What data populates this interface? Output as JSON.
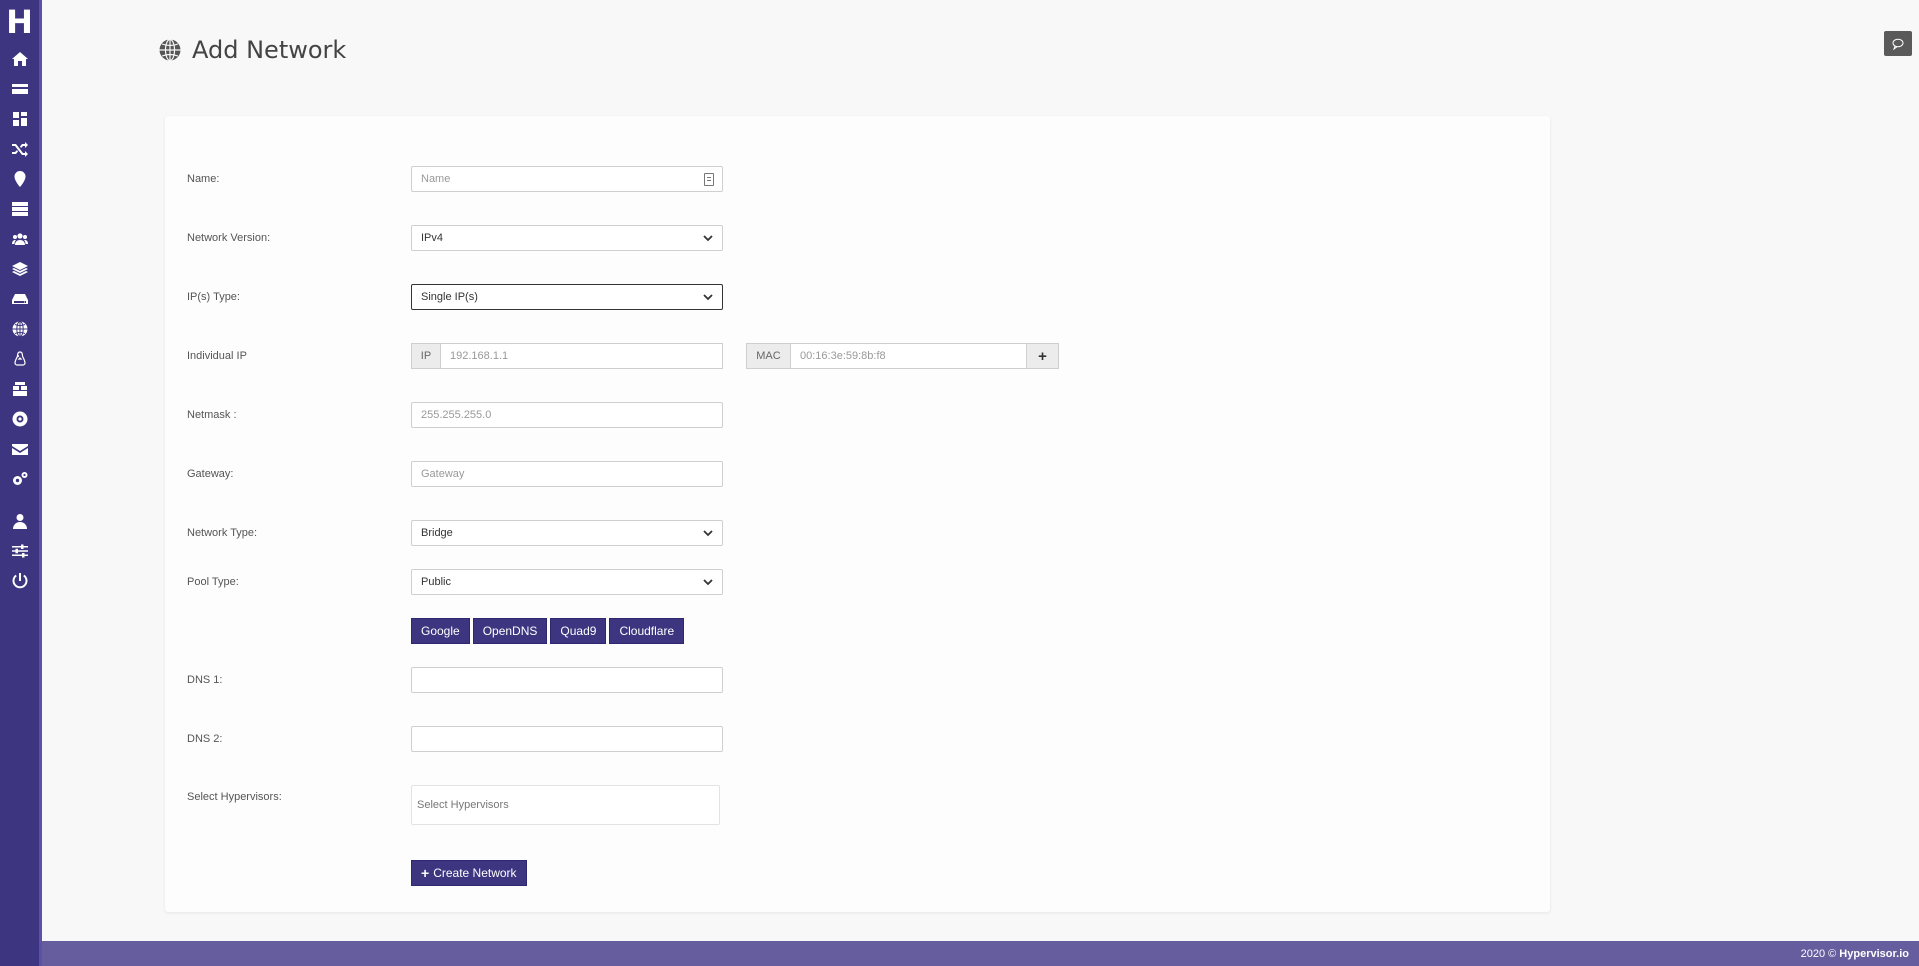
{
  "sidebar": {
    "logo": "H",
    "items": [
      {
        "icon": "home-icon",
        "name": "home"
      },
      {
        "icon": "card-icon",
        "name": "billing"
      },
      {
        "icon": "dashboard-icon",
        "name": "dashboard"
      },
      {
        "icon": "shuffle-icon",
        "name": "migrations"
      },
      {
        "icon": "location-pin-icon",
        "name": "locations"
      },
      {
        "icon": "server-icon",
        "name": "servers"
      },
      {
        "icon": "users-icon",
        "name": "users"
      },
      {
        "icon": "layers-icon",
        "name": "layers"
      },
      {
        "icon": "hard-drive-icon",
        "name": "storage"
      },
      {
        "icon": "globe-icon",
        "name": "networks"
      },
      {
        "icon": "linux-icon",
        "name": "os-templates"
      },
      {
        "icon": "boxes-icon",
        "name": "packages"
      },
      {
        "icon": "disc-icon",
        "name": "isos"
      },
      {
        "icon": "envelope-icon",
        "name": "mail"
      },
      {
        "icon": "cogs-icon",
        "name": "settings"
      }
    ],
    "bottom_items": [
      {
        "icon": "user-icon",
        "name": "profile"
      },
      {
        "icon": "sliders-icon",
        "name": "preferences"
      },
      {
        "icon": "power-icon",
        "name": "logout"
      }
    ]
  },
  "header": {
    "title": "Add Network"
  },
  "form": {
    "name": {
      "label": "Name:",
      "placeholder": "Name"
    },
    "network_version": {
      "label": "Network Version:",
      "value": "IPv4"
    },
    "ip_type": {
      "label": "IP(s) Type:",
      "value": "Single IP(s)"
    },
    "individual_ip": {
      "label": "Individual IP",
      "ip_addon": "IP",
      "ip_placeholder": "192.168.1.1",
      "mac_addon": "MAC",
      "mac_placeholder": "00:16:3e:59:8b:f8",
      "add_label": "+"
    },
    "netmask": {
      "label": "Netmask :",
      "placeholder": "255.255.255.0"
    },
    "gateway": {
      "label": "Gateway:",
      "placeholder": "Gateway"
    },
    "network_type": {
      "label": "Network Type:",
      "value": "Bridge"
    },
    "pool_type": {
      "label": "Pool Type:",
      "value": "Public"
    },
    "dns_presets": [
      "Google",
      "OpenDNS",
      "Quad9",
      "Cloudflare"
    ],
    "dns1": {
      "label": "DNS 1:",
      "value": ""
    },
    "dns2": {
      "label": "DNS 2:",
      "value": ""
    },
    "hypervisors": {
      "label": "Select Hypervisors:",
      "placeholder": "Select Hypervisors"
    },
    "submit": {
      "plus": "+",
      "label": "Create Network"
    }
  },
  "footer": {
    "year": "2020 ©",
    "brand": "Hypervisor.io"
  },
  "colors": {
    "sidebar": "#3d3580",
    "accent": "#3d3580",
    "footer": "#655d9e"
  }
}
